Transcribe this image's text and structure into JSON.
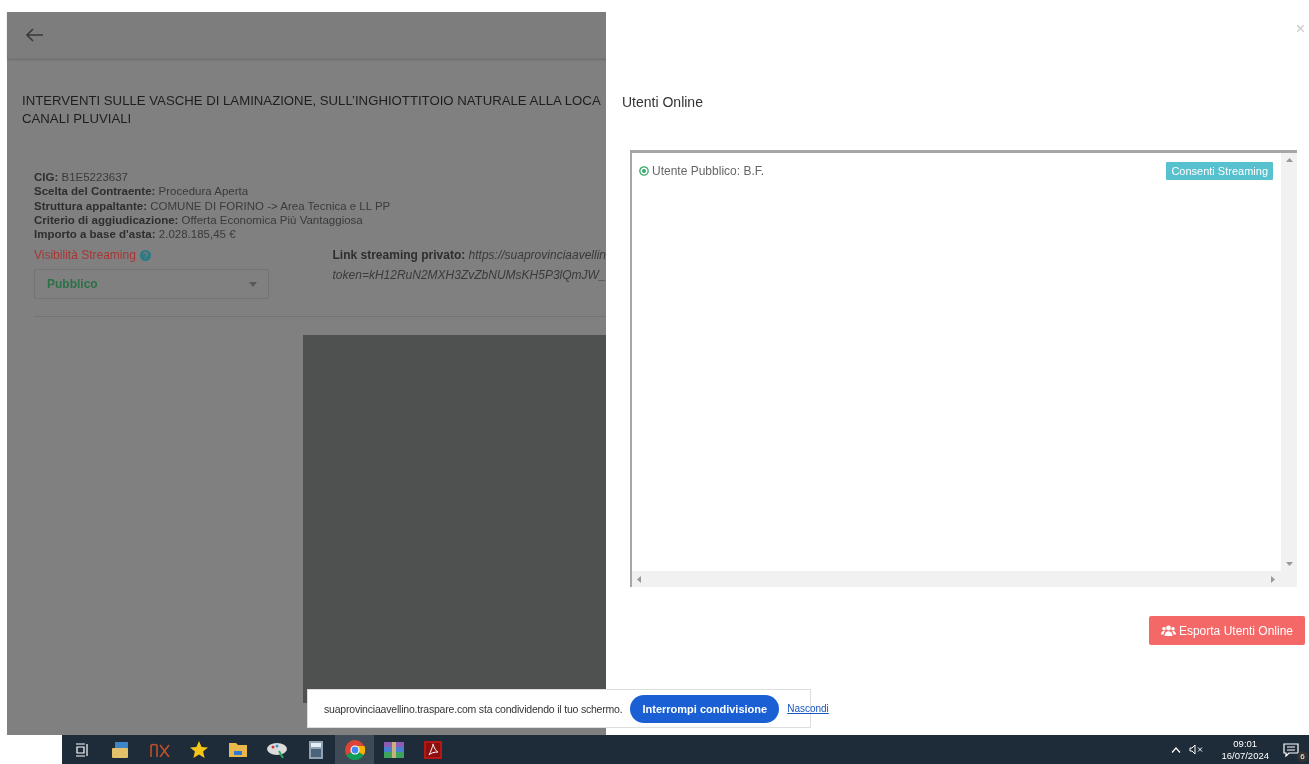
{
  "page": {
    "title_lines": [
      "INTERVENTI SULLE VASCHE DI LAMINAZIONE, SULL’INGHIOTTITOIO NATURALE ALLA LOCA",
      "CANALI PLUVIALI"
    ],
    "details": [
      {
        "label": "CIG:",
        "value": "B1E5223637"
      },
      {
        "label": "Scelta del Contraente:",
        "value": "Procedura Aperta"
      },
      {
        "label": "Struttura appaltante:",
        "value": "COMUNE DI FORINO -> Area Tecnica e LL PP"
      },
      {
        "label": "Criterio di aggiudicazione:",
        "value": "Offerta Economica Più Vantaggiosa"
      },
      {
        "label": "Importo a base d'asta:",
        "value": "2.028.185,45 €"
      }
    ],
    "visibility": {
      "label": "Visibilità Streaming",
      "value": "Pubblico"
    },
    "private_link": {
      "label": "Link streaming privato:",
      "url_lines": [
        "https://suaprovinciaavellin",
        "token=kH12RuN2MXH3ZvZbNUMsKH5P3lQmJW_"
      ]
    }
  },
  "panel": {
    "close": "×",
    "title": "Utenti Online",
    "users": [
      {
        "label": "Utente Pubblico: B.F.",
        "action": "Consenti Streaming"
      }
    ],
    "export_button": "Esporta Utenti Online"
  },
  "share_bar": {
    "message": "suaprovinciaavellino.traspare.com sta condividendo il tuo schermo.",
    "stop_button": "Interrompi condivisione",
    "hide_link": "Nascondi"
  },
  "taskbar": {
    "apps": [
      {
        "kind": "taskview",
        "selected": false
      },
      {
        "kind": "mail",
        "selected": false
      },
      {
        "kind": "nx",
        "selected": false
      },
      {
        "kind": "star",
        "selected": false
      },
      {
        "kind": "folder",
        "selected": false
      },
      {
        "kind": "paint",
        "selected": false
      },
      {
        "kind": "calculator",
        "selected": false
      },
      {
        "kind": "chrome",
        "selected": true
      },
      {
        "kind": "archive",
        "selected": false
      },
      {
        "kind": "pdf",
        "selected": false
      }
    ],
    "time": "09:01",
    "date": "16/07/2024",
    "notifications": "6"
  }
}
